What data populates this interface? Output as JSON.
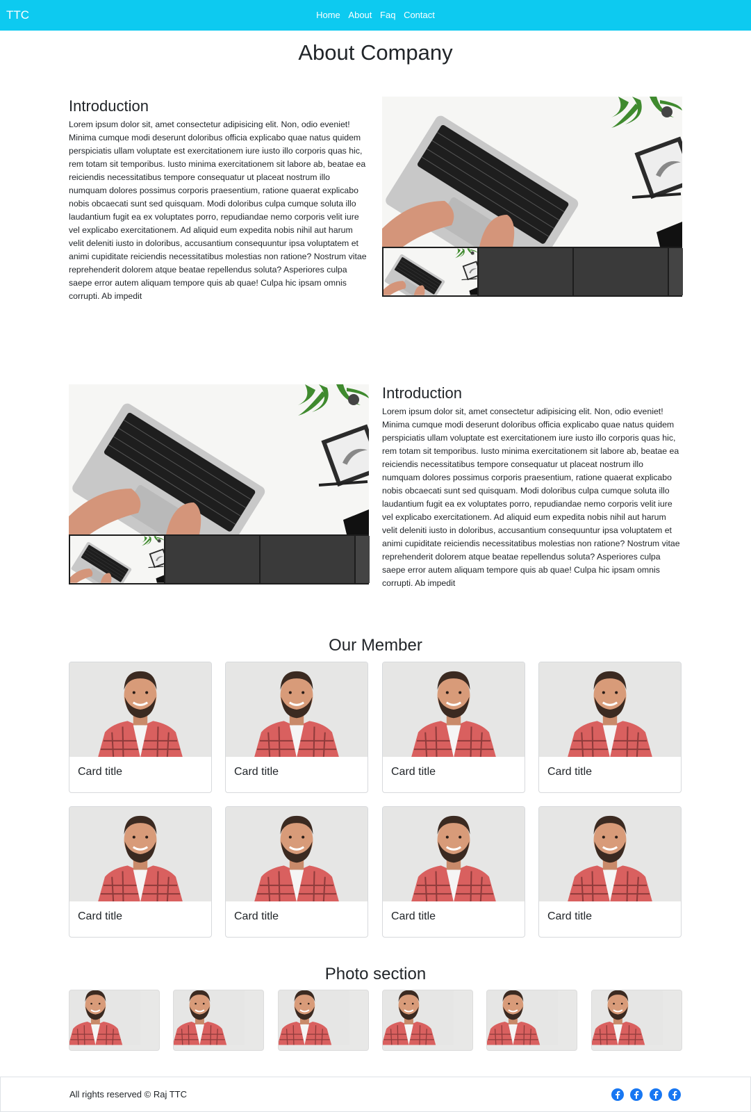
{
  "navbar": {
    "brand": "TTC",
    "links": [
      "Home",
      "About",
      "Faq",
      "Contact"
    ],
    "color": "#0dcaf0"
  },
  "page_title": "About Company",
  "intro_1": {
    "heading": "Introduction",
    "text": "Lorem ipsum dolor sit, amet consectetur adipisicing elit. Non, odio eveniet! Minima cumque modi deserunt doloribus officia explicabo quae natus quidem perspiciatis ullam voluptate est exercitationem iure iusto illo corporis quas hic, rem totam sit temporibus. Iusto minima exercitationem sit labore ab, beatae ea reiciendis necessitatibus tempore consequatur ut placeat nostrum illo numquam dolores possimus corporis praesentium, ratione quaerat explicabo nobis obcaecati sunt sed quisquam. Modi doloribus culpa cumque soluta illo laudantium fugit ea ex voluptates porro, repudiandae nemo corporis velit iure vel explicabo exercitationem. Ad aliquid eum expedita nobis nihil aut harum velit deleniti iusto in doloribus, accusantium consequuntur ipsa voluptatem et animi cupiditate reiciendis necessitatibus molestias non ratione? Nostrum vitae reprehenderit dolorem atque beatae repellendus soluta? Asperiores culpa saepe error autem aliquam tempore quis ab quae! Culpa hic ipsam omnis corrupti. Ab impedit"
  },
  "intro_2": {
    "heading": "Introduction",
    "text": "Lorem ipsum dolor sit, amet consectetur adipisicing elit. Non, odio eveniet! Minima cumque modi deserunt doloribus officia explicabo quae natus quidem perspiciatis ullam voluptate est exercitationem iure iusto illo corporis quas hic, rem totam sit temporibus. Iusto minima exercitationem sit labore ab, beatae ea reiciendis necessitatibus tempore consequatur ut placeat nostrum illo numquam dolores possimus corporis praesentium, ratione quaerat explicabo nobis obcaecati sunt sed quisquam. Modi doloribus culpa cumque soluta illo laudantium fugit ea ex voluptates porro, repudiandae nemo corporis velit iure vel explicabo exercitationem. Ad aliquid eum expedita nobis nihil aut harum velit deleniti iusto in doloribus, accusantium consequuntur ipsa voluptatem et animi cupiditate reiciendis necessitatibus molestias non ratione? Nostrum vitae reprehenderit dolorem atque beatae repellendus soluta? Asperiores culpa saepe error autem aliquam tempore quis ab quae! Culpa hic ipsam omnis corrupti. Ab impedit"
  },
  "members": {
    "title": "Our Member",
    "cards": [
      "Card title",
      "Card title",
      "Card title",
      "Card title",
      "Card title",
      "Card title",
      "Card title",
      "Card title"
    ]
  },
  "photos": {
    "title": "Photo section",
    "count": 6
  },
  "footer": {
    "text": "All rights reserved © Raj TTC",
    "social_icons": [
      "facebook-icon",
      "facebook-icon",
      "facebook-icon",
      "facebook-icon"
    ],
    "social_color": "#1877f2"
  }
}
